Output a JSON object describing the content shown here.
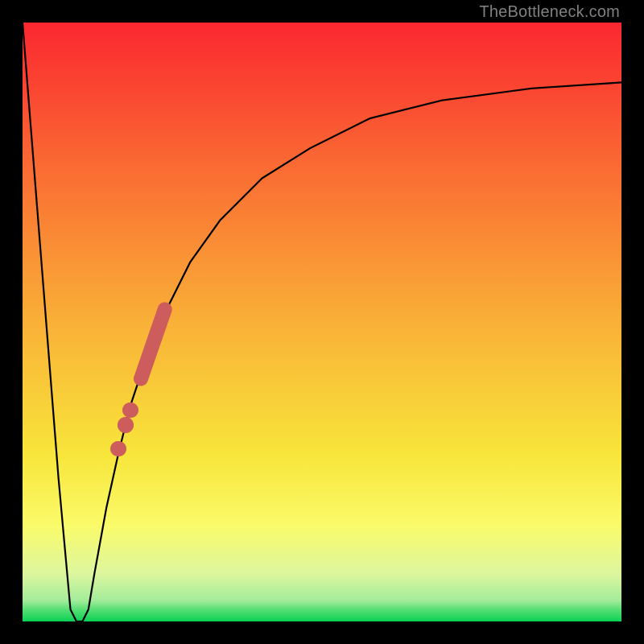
{
  "watermark": "TheBottleneck.com",
  "gradient": {
    "c0": "#fb2730",
    "c1": "#fa6d33",
    "c2": "#f9b037",
    "c3": "#f8e53a",
    "c4": "#fafb6a",
    "c5": "#ddf69e",
    "c6": "#a3ec9a",
    "c7": "#57df74",
    "c8": "#0ad153"
  },
  "chart_data": {
    "type": "line",
    "xlabel": "",
    "ylabel": "",
    "xlim": [
      0,
      100
    ],
    "ylim": [
      0,
      100
    ],
    "title": "",
    "series": [
      {
        "name": "bottleneck-curve",
        "x": [
          0,
          6,
          8,
          9,
          10,
          11,
          12,
          14,
          16,
          18,
          21,
          24,
          28,
          33,
          40,
          48,
          58,
          70,
          85,
          100
        ],
        "y": [
          100,
          24,
          2,
          0,
          0,
          2,
          8,
          19,
          28,
          36,
          45,
          52,
          60,
          67,
          74,
          79,
          84,
          87,
          89,
          90
        ]
      }
    ],
    "markers": {
      "pill": {
        "x1": 19.4,
        "y1": 39.4,
        "x2": 24.2,
        "y2": 53.3,
        "width_pct": 2.4
      },
      "dots": [
        {
          "x": 18.0,
          "y": 35.3,
          "r_pct": 1.3
        },
        {
          "x": 17.2,
          "y": 32.8,
          "r_pct": 1.3
        },
        {
          "x": 16.0,
          "y": 28.8,
          "r_pct": 1.3
        }
      ]
    }
  }
}
